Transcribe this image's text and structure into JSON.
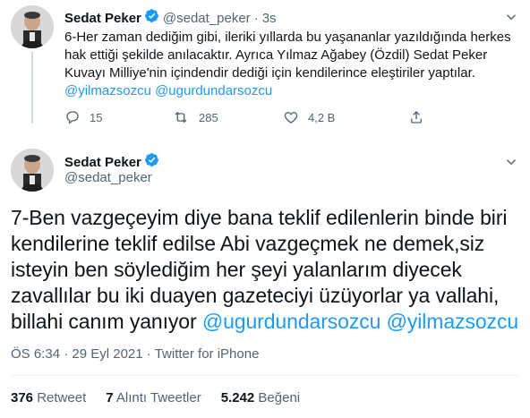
{
  "tweet1": {
    "name": "Sedat Peker",
    "handle": "@sedat_peker",
    "sep": "·",
    "time": "3s",
    "text": "6-Her zaman dediğim gibi, ileriki yıllarda bu yaşananlar yazıldığında herkes hak ettiği şekilde anılacaktır. Ayrıca Yılmaz Ağabey (Özdil) Sedat Peker Kuvayı Milliye'nin içindendir dediği için kendilerince eleştiriler yaptılar.",
    "mentions": "@yilmazsozcu @ugurdundarsozcu",
    "reply_count": "15",
    "retweet_count": "285",
    "like_count": "4,2 B"
  },
  "tweet2": {
    "name": "Sedat Peker",
    "handle": "@sedat_peker",
    "text": "7-Ben vazgeçeyim diye bana teklif edilenlerin binde biri kendilerine teklif edilse Abi vazgeçmek ne demek,siz isteyin ben söylediğim her şeyi yalanlarım diyecek zavallılar bu iki duayen gazeteciyi üzüyorlar ya vallahi, billahi canım yanıyor",
    "mention1": "@ugurdundarsozcu",
    "mention2": "@yilmazsozcu",
    "time": "ÖS 6:34",
    "sep": "·",
    "date": "29 Eyl 2021",
    "source_sep": "·",
    "source": "Twitter for iPhone"
  },
  "stats": {
    "retweets_count": "376",
    "retweets_label": "Retweet",
    "quotes_count": "7",
    "quotes_label": "Alıntı Tweetler",
    "likes_count": "5.242",
    "likes_label": "Beğeni"
  },
  "colors": {
    "accent": "#1d9bf0",
    "secondary_text": "#536471",
    "divider": "#eff3f4"
  },
  "icons": [
    "verified-badge-icon",
    "caret-down-icon",
    "reply-icon",
    "retweet-icon",
    "like-icon",
    "share-icon"
  ]
}
